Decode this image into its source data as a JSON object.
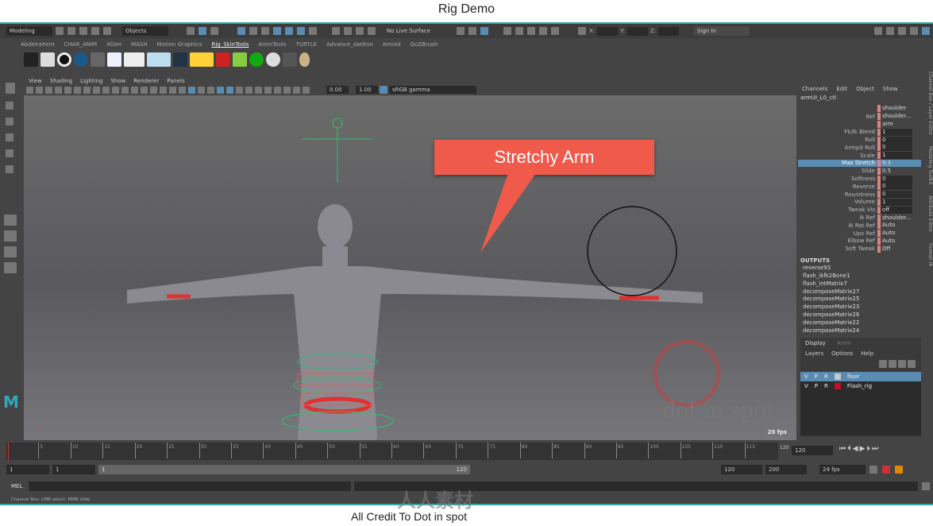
{
  "header_title": "Rig Demo",
  "footer_credit": "All Credit To  Dot in spot",
  "watermark": "人人素材",
  "toolbar": {
    "mode": "Modeling",
    "objects": "Objects",
    "live_surface": "No Live Surface",
    "sign_in": "Sign In",
    "x_label": "X:",
    "y_label": "Y:",
    "z_label": "Z:"
  },
  "shelf_tabs": [
    "Abdelrahem",
    "CHAR_ANIM",
    "XGen",
    "MASH",
    "Motion Graphics",
    "Rig_SkinTools",
    "AnimTools",
    "TURTLE",
    "Advance_skelton",
    "Arnold",
    "GoZBrush"
  ],
  "shelf_active": 5,
  "viewport": {
    "menus": [
      "View",
      "Shading",
      "Lighting",
      "Show",
      "Renderer",
      "Panels"
    ],
    "exposure": "0.00",
    "gamma": "1.00",
    "color_space": "sRGB gamma",
    "fps": "20 fps",
    "callout": "Stretchy Arm",
    "logo": "dot in spot",
    "callout_color": "#f05a4a"
  },
  "channel_box": {
    "menus": [
      "Channels",
      "Edit",
      "Object",
      "Show"
    ],
    "object": "armUI_L0_ctl",
    "rows": [
      {
        "name": "",
        "value": "shoulder"
      },
      {
        "name": "Ref",
        "value": "shoulder..."
      },
      {
        "name": "",
        "value": "arm"
      },
      {
        "name": "Fk/Ik Blend",
        "value": "1"
      },
      {
        "name": "Roll",
        "value": "0"
      },
      {
        "name": "Armpit Roll",
        "value": "0"
      },
      {
        "name": "Scale",
        "value": "1"
      },
      {
        "name": "Max Stretch",
        "value": "9.3",
        "selected": true
      },
      {
        "name": "Slide",
        "value": "0.5"
      },
      {
        "name": "Softness",
        "value": "0"
      },
      {
        "name": "Reverse",
        "value": "0"
      },
      {
        "name": "Roundness",
        "value": "0"
      },
      {
        "name": "Volume",
        "value": "1"
      },
      {
        "name": "Tweak Vis",
        "value": "off"
      },
      {
        "name": "Ik Ref",
        "value": "shoulder..."
      },
      {
        "name": "Ik Rot Ref",
        "value": "Auto"
      },
      {
        "name": "Upv Ref",
        "value": "Auto"
      },
      {
        "name": "Elbow Ref",
        "value": "Auto"
      },
      {
        "name": "Soft Tweak",
        "value": "Off"
      }
    ],
    "outputs_label": "OUTPUTS",
    "outputs": [
      "reverse93",
      "flash_ikfk2Bone1",
      "flash_intMatrix7",
      "decomposeMatrix27",
      "decomposeMatrix25",
      "decomposeMatrix23",
      "decomposeMatrix26",
      "decomposeMatrix22",
      "decomposeMatrix24"
    ]
  },
  "side_tabs": [
    "Channel Box / Layer Editor",
    "Modeling Toolkit",
    "Attribute Editor",
    "Human IK"
  ],
  "layer_editor": {
    "tabs": [
      "Display",
      "Anim"
    ],
    "menus": [
      "Layers",
      "Options",
      "Help"
    ],
    "layers": [
      {
        "v": "V",
        "p": "P",
        "r": "R",
        "name": "floor",
        "color": "#c8c8c8",
        "selected": true
      },
      {
        "v": "V",
        "p": "P",
        "r": "R",
        "name": "Flash_rig",
        "color": "#c0102a"
      }
    ]
  },
  "timeline": {
    "ticks": [
      5,
      10,
      15,
      20,
      25,
      30,
      35,
      40,
      45,
      50,
      55,
      60,
      65,
      70,
      75,
      80,
      85,
      90,
      95,
      100,
      105,
      110,
      115
    ],
    "current_frame": "120",
    "end_label": "120"
  },
  "range": {
    "start": "1",
    "playback_start": "1",
    "slider_start": "1",
    "slider_end": "120",
    "playback_end": "120",
    "end": "200",
    "fps": "24 fps"
  },
  "command_line": {
    "label": "MEL"
  },
  "help_line": "Channel Box: LMB select. MMB slide"
}
